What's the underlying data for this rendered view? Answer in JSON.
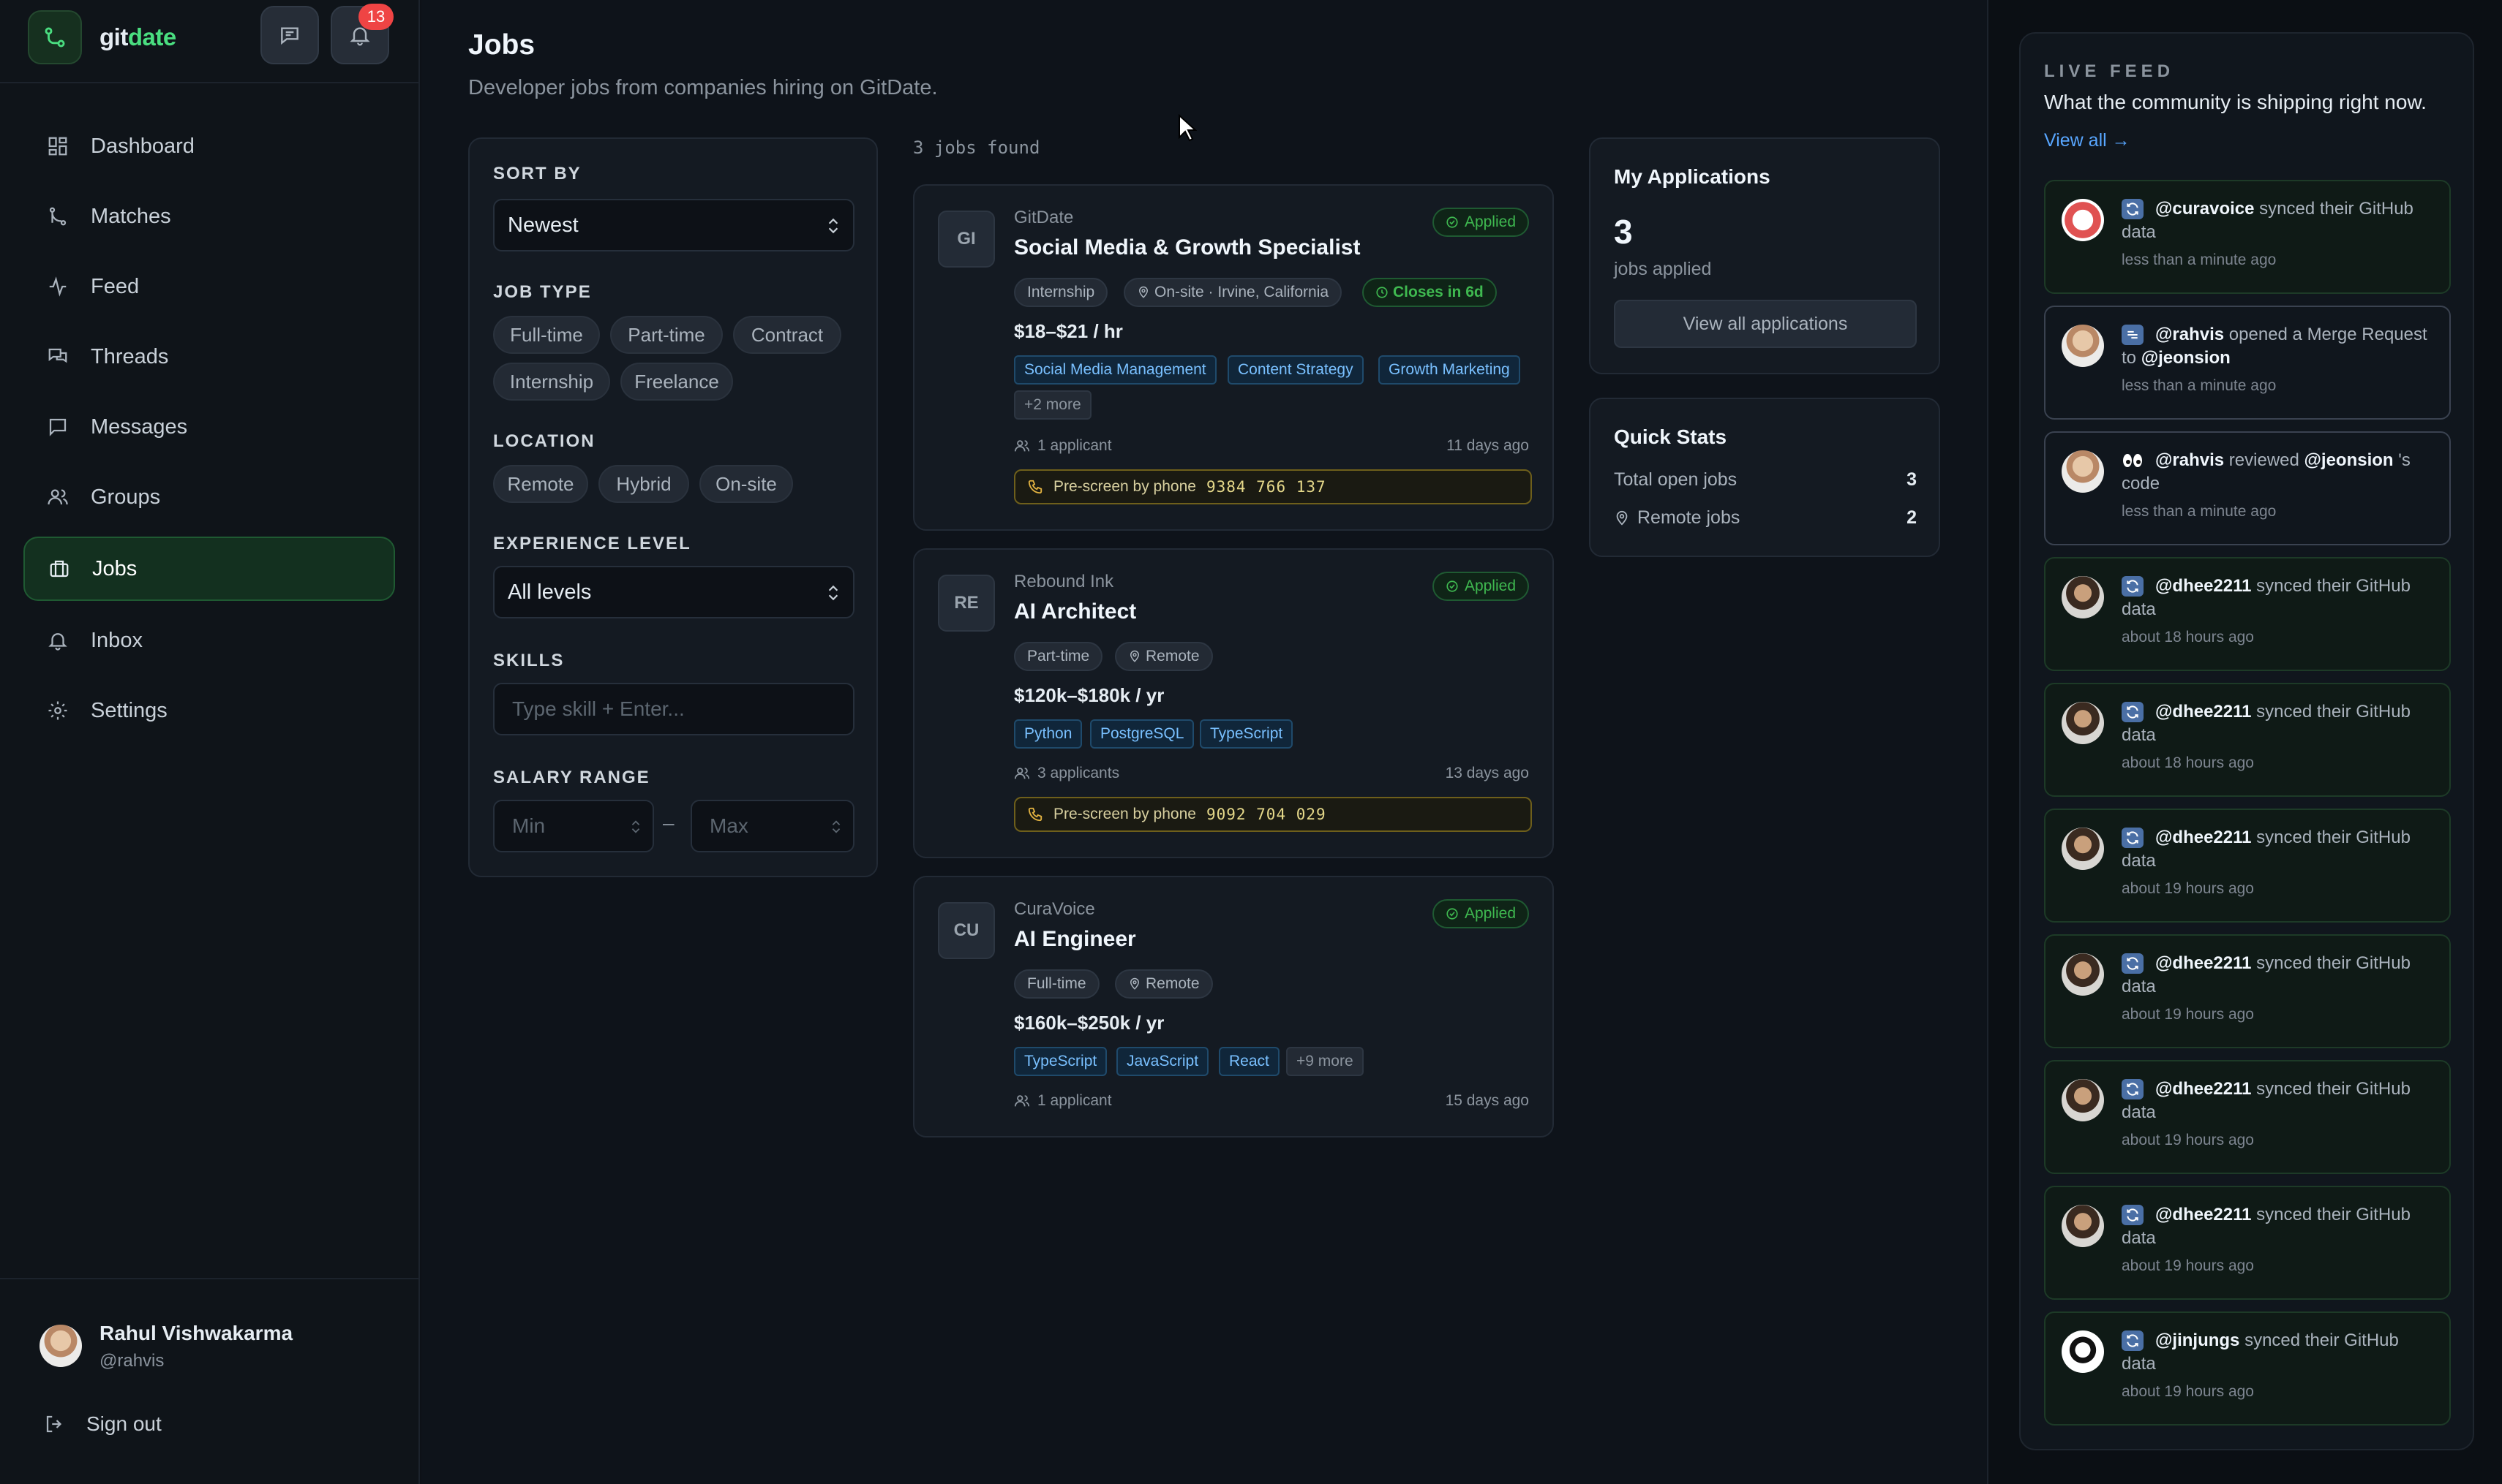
{
  "brand": {
    "part1": "git",
    "part2": "date"
  },
  "header": {
    "notification_count": "13"
  },
  "nav": [
    {
      "label": "Dashboard",
      "icon": "dashboard-icon"
    },
    {
      "label": "Matches",
      "icon": "git-merge-icon"
    },
    {
      "label": "Feed",
      "icon": "activity-icon"
    },
    {
      "label": "Threads",
      "icon": "threads-icon"
    },
    {
      "label": "Messages",
      "icon": "message-icon"
    },
    {
      "label": "Groups",
      "icon": "users-icon"
    },
    {
      "label": "Jobs",
      "icon": "briefcase-icon",
      "active": true
    },
    {
      "label": "Inbox",
      "icon": "bell-icon"
    },
    {
      "label": "Settings",
      "icon": "gear-icon"
    }
  ],
  "user": {
    "name": "Rahul Vishwakarma",
    "handle": "@rahvis",
    "signout": "Sign out"
  },
  "page": {
    "title": "Jobs",
    "subtitle": "Developer jobs from companies hiring on GitDate."
  },
  "filters": {
    "sort_label": "SORT BY",
    "sort_value": "Newest",
    "job_type_label": "JOB TYPE",
    "job_types": [
      "Full-time",
      "Part-time",
      "Contract",
      "Internship",
      "Freelance"
    ],
    "location_label": "LOCATION",
    "locations": [
      "Remote",
      "Hybrid",
      "On-site"
    ],
    "experience_label": "EXPERIENCE LEVEL",
    "experience_value": "All levels",
    "skills_label": "SKILLS",
    "skills_placeholder": "Type skill + Enter...",
    "salary_label": "SALARY RANGE",
    "salary_min_placeholder": "Min",
    "salary_max_placeholder": "Max",
    "salary_separator": "–"
  },
  "jobs_found": "3 jobs found",
  "jobs": [
    {
      "initials": "GI",
      "company": "GitDate",
      "title": "Social Media & Growth Specialist",
      "status": "Applied",
      "type": "Internship",
      "location": "On-site · Irvine, California",
      "closes": "Closes in 6d",
      "salary": "$18–$21 / hr",
      "skills": [
        "Social Media Management",
        "Content Strategy",
        "Growth Marketing"
      ],
      "more": "+2 more",
      "applicants": "1 applicant",
      "posted": "11 days ago",
      "prescreen_label": "Pre-screen by phone",
      "prescreen_number": "9384 766 137"
    },
    {
      "initials": "RE",
      "company": "Rebound Ink",
      "title": "AI Architect",
      "status": "Applied",
      "type": "Part-time",
      "location": "Remote",
      "salary": "$120k–$180k / yr",
      "skills": [
        "Python",
        "PostgreSQL",
        "TypeScript"
      ],
      "applicants": "3 applicants",
      "posted": "13 days ago",
      "prescreen_label": "Pre-screen by phone",
      "prescreen_number": "9092 704 029"
    },
    {
      "initials": "CU",
      "company": "CuraVoice",
      "title": "AI Engineer",
      "status": "Applied",
      "type": "Full-time",
      "location": "Remote",
      "salary": "$160k–$250k / yr",
      "skills": [
        "TypeScript",
        "JavaScript",
        "React"
      ],
      "more": "+9 more",
      "applicants": "1 applicant",
      "posted": "15 days ago"
    }
  ],
  "my_applications": {
    "title": "My Applications",
    "count": "3",
    "label": "jobs applied",
    "button": "View all applications"
  },
  "quick_stats": {
    "title": "Quick Stats",
    "rows": [
      {
        "label": "Total open jobs",
        "value": "3"
      },
      {
        "label": "Remote jobs",
        "value": "2"
      }
    ]
  },
  "feed": {
    "heading": "LIVE FEED",
    "subtitle": "What the community is shipping right now.",
    "view_all": "View all →",
    "items": [
      {
        "user": "@curavoice",
        "action": "synced their GitHub data",
        "time": "less than a minute ago",
        "icon": "sync-icon"
      },
      {
        "user": "@rahvis",
        "action": "opened a Merge Request to",
        "target": "@jeonsion",
        "time": "less than a minute ago",
        "icon": "merge-request-icon"
      },
      {
        "user": "@rahvis",
        "action": "reviewed",
        "target": "@jeonsion",
        "suffix": "'s code",
        "time": "less than a minute ago",
        "icon": "eyes-icon"
      },
      {
        "user": "@dhee2211",
        "action": "synced their GitHub data",
        "time": "about 18 hours ago",
        "icon": "sync-icon"
      },
      {
        "user": "@dhee2211",
        "action": "synced their GitHub data",
        "time": "about 18 hours ago",
        "icon": "sync-icon"
      },
      {
        "user": "@dhee2211",
        "action": "synced their GitHub data",
        "time": "about 19 hours ago",
        "icon": "sync-icon"
      },
      {
        "user": "@dhee2211",
        "action": "synced their GitHub data",
        "time": "about 19 hours ago",
        "icon": "sync-icon"
      },
      {
        "user": "@dhee2211",
        "action": "synced their GitHub data",
        "time": "about 19 hours ago",
        "icon": "sync-icon"
      },
      {
        "user": "@dhee2211",
        "action": "synced their GitHub data",
        "time": "about 19 hours ago",
        "icon": "sync-icon"
      },
      {
        "user": "@jinjungs",
        "action": "synced their GitHub data",
        "time": "about 19 hours ago",
        "icon": "sync-icon"
      }
    ]
  },
  "colors": {
    "accent": "#4ade80",
    "applied": "#3fb950",
    "skill": "#79c0ff",
    "link": "#58a6ff",
    "badge": "#ef4444",
    "background": "#0d1117"
  }
}
